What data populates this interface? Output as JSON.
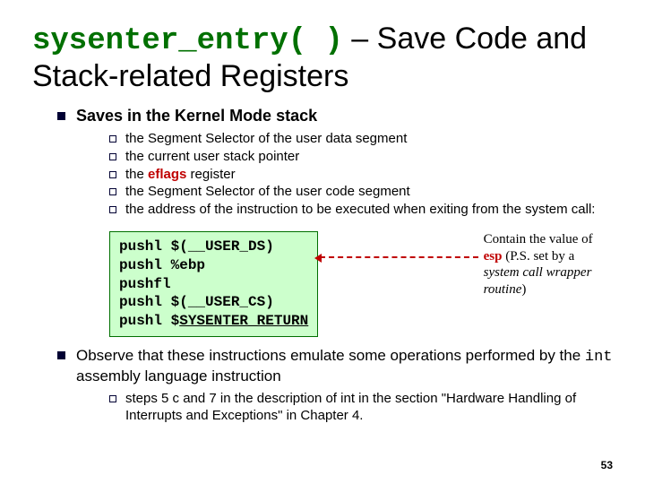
{
  "title": {
    "mono": "sysenter_entry( )",
    "sep": " – ",
    "rest": "Save Code and Stack-related Registers"
  },
  "l1a": "Saves in the Kernel Mode stack",
  "sub": [
    "the Segment Selector of the user data segment",
    "the current user stack pointer",
    "",
    "the Segment Selector of the user code segment",
    "the address of the instruction to be executed when exiting from the system call:"
  ],
  "eflags_line": {
    "pre": "the ",
    "mid": "eflags",
    "post": " register"
  },
  "code": {
    "l1": "pushl $(__USER_DS)",
    "l2": "pushl %ebp",
    "l3": "pushfl",
    "l4": "pushl $(__USER_CS)",
    "l5a": "pushl $",
    "l5b": "SYSENTER_RETURN"
  },
  "note": {
    "t1": "Contain the value of ",
    "esp": "esp",
    "t2": " (P.S. set by a ",
    "ital": "system call wrapper routine",
    "t3": ")"
  },
  "observe": {
    "l1a": "Observe that these instructions emulate some operations performed by the ",
    "int": "int",
    "l1b": " assembly language instruction",
    "sub_a": "steps 5 c and 7 in the description of ",
    "sub_int": "int",
    "sub_b": " in the section \"Hardware Handling of Interrupts and Exceptions\" in Chapter 4."
  },
  "page": "53"
}
